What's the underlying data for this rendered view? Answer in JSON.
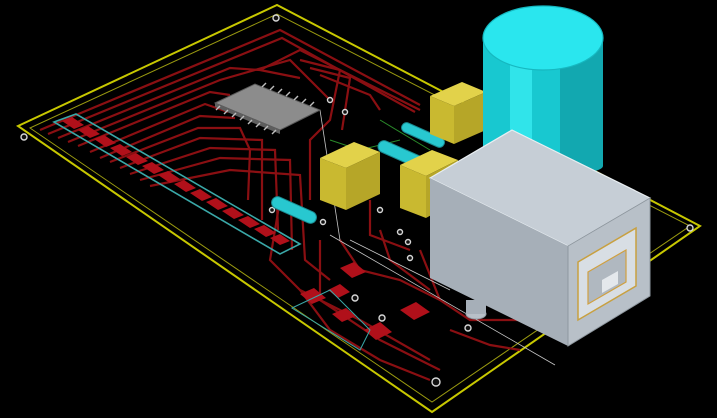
{
  "viewer": {
    "mode": "3d-board-view",
    "background_color": "#000000"
  },
  "colors": {
    "board_outline": "#c8c800",
    "copper_trace": "#8a0f12",
    "trace_highlight": "#c0181e",
    "pad": "#b0101a",
    "via_ring": "#d8d8d8",
    "ic_body": "#8c8c8c",
    "capacitor_body": "#1ee0e8",
    "ceramic_cap": "#28c8d0",
    "yellow_component": "#d4c43a",
    "usb_shell": "#b8c0c8",
    "edge_connector": "#3aa8a8",
    "silkscreen_line": "#c8c8c8"
  },
  "components": [
    {
      "id": "U1",
      "type": "tssop-ic",
      "icon": "ic-chip-icon"
    },
    {
      "id": "C1",
      "type": "electrolytic-capacitor",
      "icon": "capacitor-icon"
    },
    {
      "id": "C2",
      "type": "ceramic-capacitor",
      "icon": "capacitor-icon"
    },
    {
      "id": "C3",
      "type": "ceramic-capacitor",
      "icon": "capacitor-icon"
    },
    {
      "id": "Y1",
      "type": "smd-block",
      "icon": "component-icon"
    },
    {
      "id": "Y2",
      "type": "smd-block",
      "icon": "component-icon"
    },
    {
      "id": "Y3",
      "type": "smd-block",
      "icon": "component-icon"
    },
    {
      "id": "J1",
      "type": "usb-b-connector",
      "icon": "usb-connector-icon"
    },
    {
      "id": "J2",
      "type": "edge-connector-pads",
      "icon": "edge-connector-icon"
    }
  ]
}
